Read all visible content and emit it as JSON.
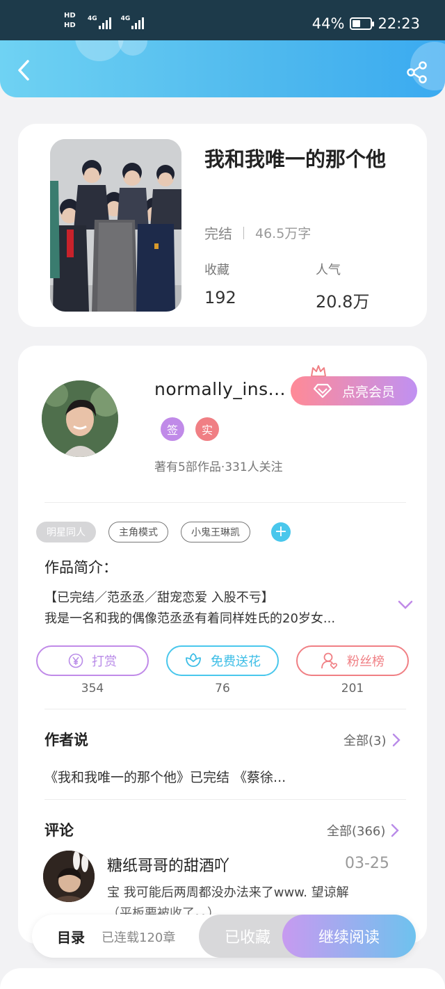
{
  "status_bar": {
    "hd1": "HD",
    "hd2": "HD",
    "net1": "4G",
    "net2": "4G",
    "battery": "44%",
    "battery_level": 0.44,
    "time": "22:23"
  },
  "header": {
    "back_icon": "back-arrow-icon",
    "share_icon": "share-icon"
  },
  "book": {
    "title": "我和我唯一的那个他",
    "status": "完结",
    "word_count": "46.5万字",
    "favorites_label": "收藏",
    "favorites_value": "192",
    "popularity_label": "人气",
    "popularity_value": "20.8万"
  },
  "author": {
    "name": "normally_ins...",
    "vip_label": "点亮会员",
    "badge_sign": "签",
    "badge_real": "实",
    "meta": "著有5部作品·331人关注"
  },
  "tags": [
    "明星同人",
    "主角模式",
    "小鬼王琳凯"
  ],
  "intro": {
    "title": "作品简介：",
    "line1": "【已完结／范丞丞／甜宠恋爱 入股不亏】",
    "line2": "我是一名和我的偶像范丞丞有着同样姓氏的20岁女..."
  },
  "actions": {
    "reward_label": "打赏",
    "reward_count": "354",
    "flower_label": "免费送花",
    "flower_count": "76",
    "fans_label": "粉丝榜",
    "fans_count": "201"
  },
  "author_says": {
    "title": "作者说",
    "more": "全部(3)",
    "text": "《我和我唯一的那个他》已完结 《蔡徐..."
  },
  "comments": {
    "title": "评论",
    "more": "全部(366)",
    "user": "糖纸哥哥的甜酒吖",
    "date": "03-25",
    "line1": "宝 我可能后两周都没办法来了www. 望谅解",
    "line2": "（平板要被收了。。）"
  },
  "bottom": {
    "toc": "目录",
    "serial": "已连载120章",
    "collected": "已收藏",
    "continue": "继续阅读"
  },
  "colors": {
    "header_start": "#6fd2f3",
    "header_end": "#3aaaf0",
    "reward": "#b98be8",
    "flower": "#49c7ec",
    "fans": "#f07f84",
    "vip_start": "#ff8a96",
    "vip_end": "#c091f2",
    "read_start": "#c79af0",
    "read_end": "#6ec2ee"
  }
}
